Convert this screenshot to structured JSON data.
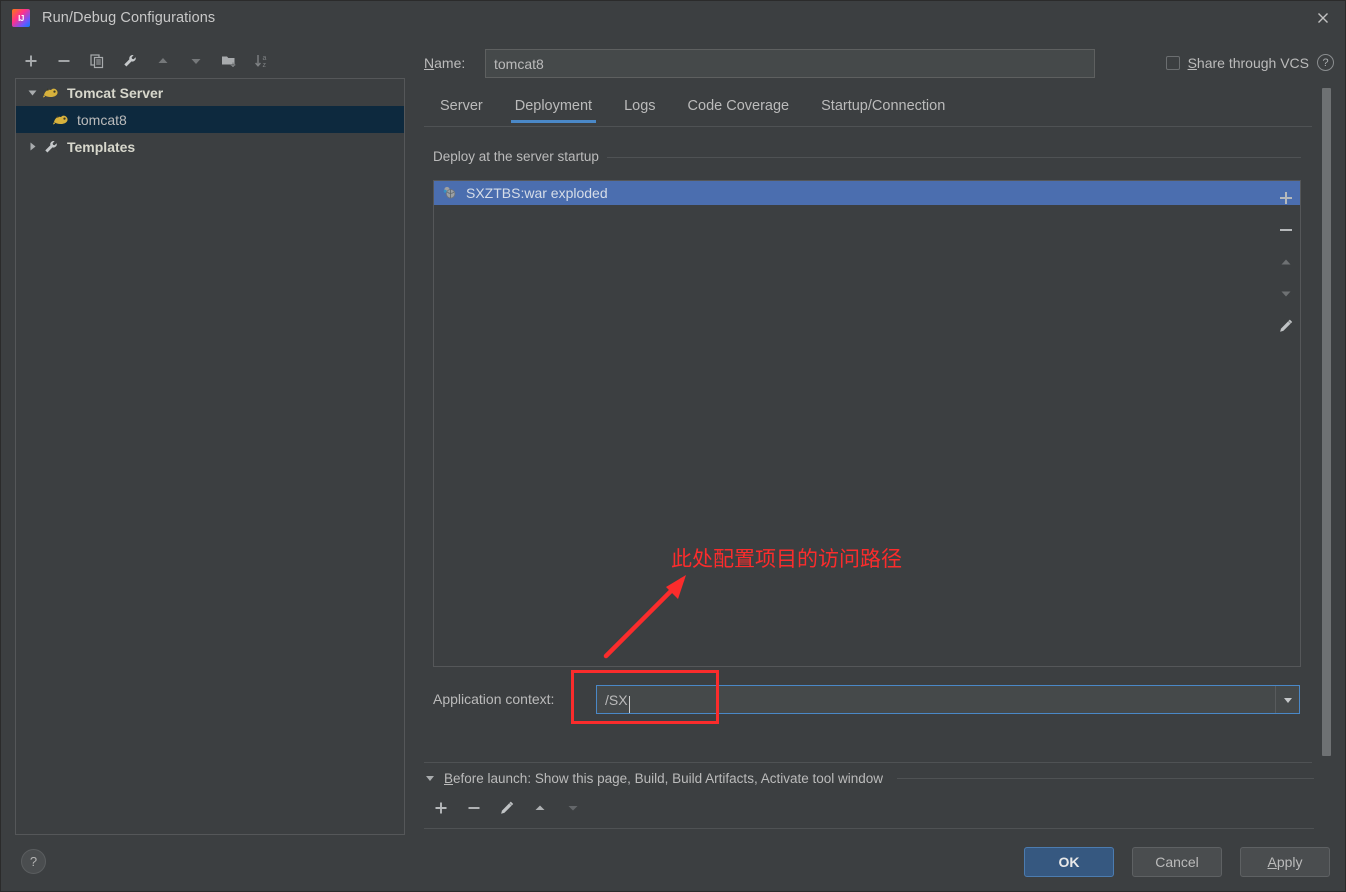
{
  "window": {
    "title": "Run/Debug Configurations",
    "app_icon": "intellij-idea-icon",
    "close_icon": "close-icon"
  },
  "left_panel": {
    "toolbar": [
      {
        "name": "add-configuration-button",
        "icon": "plus-icon",
        "label": "+"
      },
      {
        "name": "remove-configuration-button",
        "icon": "minus-icon",
        "label": "−"
      },
      {
        "name": "copy-configuration-button",
        "icon": "copy-icon",
        "label": "Copy"
      },
      {
        "name": "edit-templates-button",
        "icon": "wrench-icon",
        "label": "Edit Templates"
      },
      {
        "name": "move-up-button",
        "icon": "arrow-up-icon",
        "label": "Move Up"
      },
      {
        "name": "move-down-button",
        "icon": "arrow-down-icon",
        "label": "Move Down"
      },
      {
        "name": "new-folder-button",
        "icon": "folder-add-icon",
        "label": "New Folder"
      },
      {
        "name": "sort-configurations-button",
        "icon": "sort-az-icon",
        "label": "Sort Configurations"
      }
    ],
    "tree": [
      {
        "label": "Tomcat Server",
        "icon": "tomcat-cat-icon",
        "type": "group",
        "expanded": true,
        "selected": false
      },
      {
        "label": "tomcat8",
        "icon": "tomcat-cat-icon",
        "type": "child",
        "selected": true
      },
      {
        "label": "Templates",
        "icon": "wrench-icon",
        "type": "group",
        "expanded": false,
        "selected": false
      }
    ],
    "help_button": {
      "label": "?",
      "icon": "question-mark-icon"
    }
  },
  "header": {
    "name_label": "Name:",
    "name_label_mnemonic": "N",
    "name_label_rest": "ame:",
    "name_value": "tomcat8",
    "name_placeholder": "",
    "share_label": "Share through VCS",
    "share_mnemonic": "S",
    "share_label_rest": "hare through VCS",
    "share_checked": false,
    "help_icon": "question-mark-icon"
  },
  "tabs": [
    {
      "label": "Server",
      "active": false
    },
    {
      "label": "Deployment",
      "active": true
    },
    {
      "label": "Logs",
      "active": false
    },
    {
      "label": "Code Coverage",
      "active": false
    },
    {
      "label": "Startup/Connection",
      "active": false
    }
  ],
  "deployment": {
    "group_label": "Deploy at the server startup",
    "items": [
      {
        "label": "SXZTBS:war exploded",
        "icon": "artifact-icon",
        "selected": true
      }
    ],
    "side_toolbar": [
      {
        "name": "add-artifact-button",
        "icon": "plus-icon",
        "label": "Add"
      },
      {
        "name": "remove-artifact-button",
        "icon": "minus-icon",
        "label": "Remove"
      },
      {
        "name": "move-artifact-up-button",
        "icon": "arrow-up-icon",
        "label": "Move Up"
      },
      {
        "name": "move-artifact-down-button",
        "icon": "arrow-down-icon",
        "label": "Move Down"
      },
      {
        "name": "edit-artifact-button",
        "icon": "pencil-icon",
        "label": "Edit"
      }
    ],
    "app_context_label": "Application context:",
    "app_context_value": "/SX",
    "app_context_dropdown_icon": "chevron-down-icon"
  },
  "annotation": {
    "text": "此处配置项目的访问路径",
    "color": "#fb2c2c",
    "arrow": "red-arrow-up-right",
    "highlight_box": "red-rectangle-around-application-context"
  },
  "before_launch": {
    "expanded": true,
    "label": "Before launch: Show this page, Build, Build Artifacts, Activate tool window",
    "mnemonic": "B",
    "label_rest": "efore launch: Show this page, Build, Build Artifacts, Activate tool window",
    "toolbar": [
      {
        "name": "add-task-button",
        "icon": "plus-icon",
        "label": "Add"
      },
      {
        "name": "remove-task-button",
        "icon": "minus-icon",
        "label": "Remove"
      },
      {
        "name": "edit-task-button",
        "icon": "pencil-icon",
        "label": "Edit"
      },
      {
        "name": "task-move-up-button",
        "icon": "arrow-up-icon",
        "label": "Move Up"
      },
      {
        "name": "task-move-down-button",
        "icon": "arrow-down-icon",
        "label": "Move Down",
        "disabled": true
      }
    ]
  },
  "footer": {
    "ok_label": "OK",
    "cancel_label": "Cancel",
    "apply_label": "Apply",
    "apply_mnemonic": "A",
    "apply_label_rest": "pply"
  },
  "colors": {
    "background": "#3c3f41",
    "selection_blue": "#4b6eaf",
    "tree_selection": "#0d293e",
    "accent_tab": "#4a88c7",
    "annotation_red": "#fb2c2c",
    "default_button": "#365880",
    "field_background": "#45494a",
    "text": "#bbbbbb"
  }
}
